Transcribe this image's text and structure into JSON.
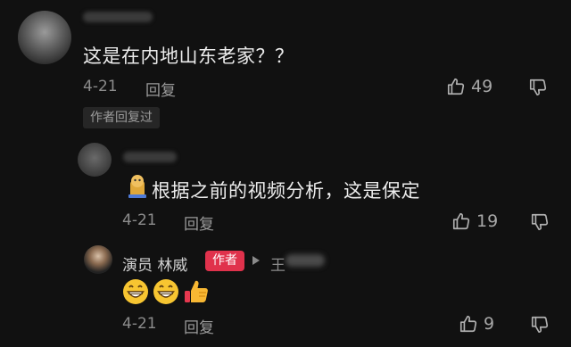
{
  "comments": [
    {
      "text": "这是在内地山东老家？？",
      "date": "4-21",
      "reply_label": "回复",
      "likes": "49",
      "author_replied_label": "作者回复过"
    },
    {
      "text": "根据之前的视频分析，这是保定",
      "date": "4-21",
      "reply_label": "回复",
      "likes": "19"
    },
    {
      "author_name": "演员 林威",
      "author_badge": "作者",
      "reply_target": "王",
      "emoji_content": [
        "grinning-face",
        "grinning-face",
        "thumbs-up"
      ],
      "date": "4-21",
      "reply_label": "回复",
      "likes": "9"
    }
  ],
  "colors": {
    "background": "#111111",
    "author_badge": "#e0324c",
    "text": "#ececec",
    "meta": "#8c8c8c"
  }
}
